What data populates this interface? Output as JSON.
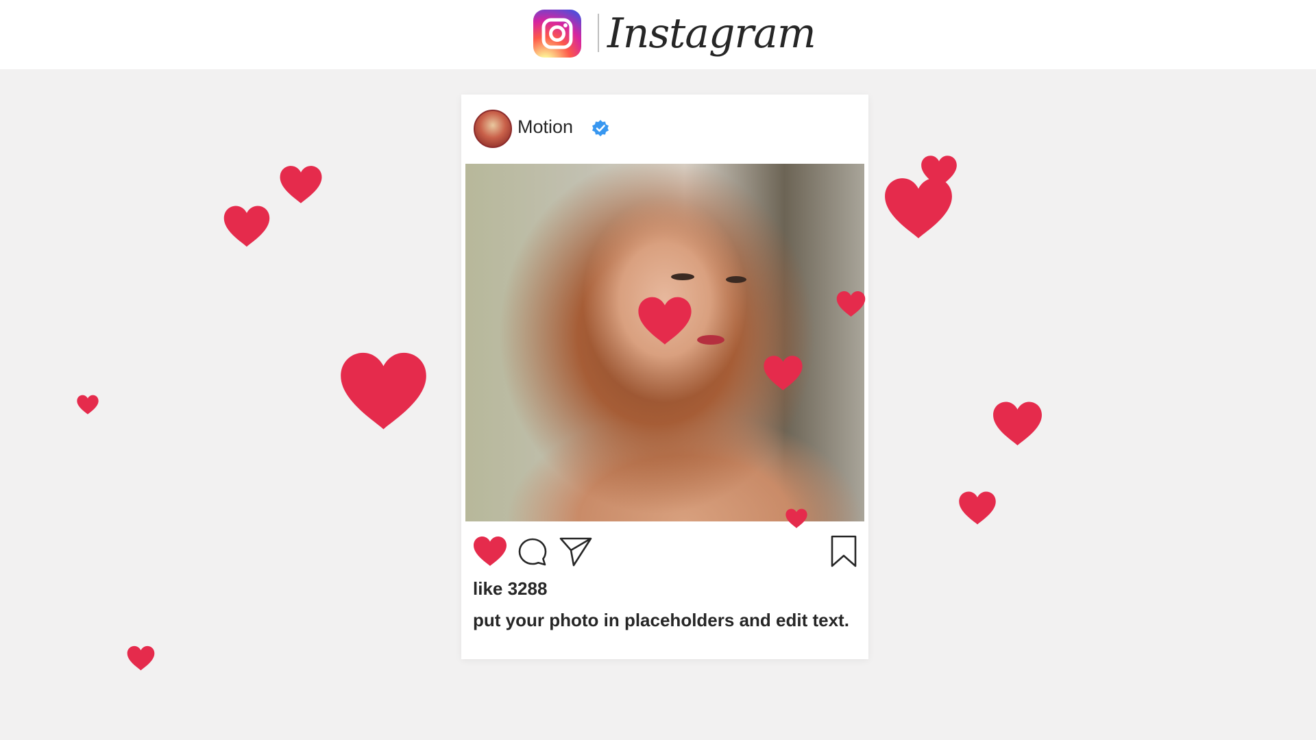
{
  "header": {
    "logo_icon": "instagram-camera-icon",
    "wordmark": "Instagram"
  },
  "post": {
    "username": "Motion",
    "verified_icon": "verified-badge-icon",
    "photo": "portrait-photo",
    "actions": {
      "like_icon": "heart-icon",
      "comment_icon": "comment-icon",
      "share_icon": "send-icon",
      "save_icon": "bookmark-icon"
    },
    "likes_text": "like 3288",
    "caption": "put your photo in placeholders and edit text."
  },
  "colors": {
    "heart": "#e52b4c",
    "accent_verified": "#3897f0",
    "text": "#262626"
  }
}
